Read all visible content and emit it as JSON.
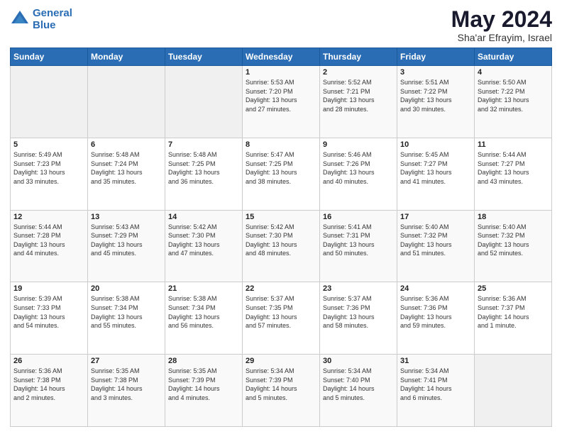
{
  "header": {
    "logo_line1": "General",
    "logo_line2": "Blue",
    "title": "May 2024",
    "subtitle": "Sha'ar Efrayim, Israel"
  },
  "days_of_week": [
    "Sunday",
    "Monday",
    "Tuesday",
    "Wednesday",
    "Thursday",
    "Friday",
    "Saturday"
  ],
  "weeks": [
    [
      {
        "day": "",
        "content": ""
      },
      {
        "day": "",
        "content": ""
      },
      {
        "day": "",
        "content": ""
      },
      {
        "day": "1",
        "content": "Sunrise: 5:53 AM\nSunset: 7:20 PM\nDaylight: 13 hours\nand 27 minutes."
      },
      {
        "day": "2",
        "content": "Sunrise: 5:52 AM\nSunset: 7:21 PM\nDaylight: 13 hours\nand 28 minutes."
      },
      {
        "day": "3",
        "content": "Sunrise: 5:51 AM\nSunset: 7:22 PM\nDaylight: 13 hours\nand 30 minutes."
      },
      {
        "day": "4",
        "content": "Sunrise: 5:50 AM\nSunset: 7:22 PM\nDaylight: 13 hours\nand 32 minutes."
      }
    ],
    [
      {
        "day": "5",
        "content": "Sunrise: 5:49 AM\nSunset: 7:23 PM\nDaylight: 13 hours\nand 33 minutes."
      },
      {
        "day": "6",
        "content": "Sunrise: 5:48 AM\nSunset: 7:24 PM\nDaylight: 13 hours\nand 35 minutes."
      },
      {
        "day": "7",
        "content": "Sunrise: 5:48 AM\nSunset: 7:25 PM\nDaylight: 13 hours\nand 36 minutes."
      },
      {
        "day": "8",
        "content": "Sunrise: 5:47 AM\nSunset: 7:25 PM\nDaylight: 13 hours\nand 38 minutes."
      },
      {
        "day": "9",
        "content": "Sunrise: 5:46 AM\nSunset: 7:26 PM\nDaylight: 13 hours\nand 40 minutes."
      },
      {
        "day": "10",
        "content": "Sunrise: 5:45 AM\nSunset: 7:27 PM\nDaylight: 13 hours\nand 41 minutes."
      },
      {
        "day": "11",
        "content": "Sunrise: 5:44 AM\nSunset: 7:27 PM\nDaylight: 13 hours\nand 43 minutes."
      }
    ],
    [
      {
        "day": "12",
        "content": "Sunrise: 5:44 AM\nSunset: 7:28 PM\nDaylight: 13 hours\nand 44 minutes."
      },
      {
        "day": "13",
        "content": "Sunrise: 5:43 AM\nSunset: 7:29 PM\nDaylight: 13 hours\nand 45 minutes."
      },
      {
        "day": "14",
        "content": "Sunrise: 5:42 AM\nSunset: 7:30 PM\nDaylight: 13 hours\nand 47 minutes."
      },
      {
        "day": "15",
        "content": "Sunrise: 5:42 AM\nSunset: 7:30 PM\nDaylight: 13 hours\nand 48 minutes."
      },
      {
        "day": "16",
        "content": "Sunrise: 5:41 AM\nSunset: 7:31 PM\nDaylight: 13 hours\nand 50 minutes."
      },
      {
        "day": "17",
        "content": "Sunrise: 5:40 AM\nSunset: 7:32 PM\nDaylight: 13 hours\nand 51 minutes."
      },
      {
        "day": "18",
        "content": "Sunrise: 5:40 AM\nSunset: 7:32 PM\nDaylight: 13 hours\nand 52 minutes."
      }
    ],
    [
      {
        "day": "19",
        "content": "Sunrise: 5:39 AM\nSunset: 7:33 PM\nDaylight: 13 hours\nand 54 minutes."
      },
      {
        "day": "20",
        "content": "Sunrise: 5:38 AM\nSunset: 7:34 PM\nDaylight: 13 hours\nand 55 minutes."
      },
      {
        "day": "21",
        "content": "Sunrise: 5:38 AM\nSunset: 7:34 PM\nDaylight: 13 hours\nand 56 minutes."
      },
      {
        "day": "22",
        "content": "Sunrise: 5:37 AM\nSunset: 7:35 PM\nDaylight: 13 hours\nand 57 minutes."
      },
      {
        "day": "23",
        "content": "Sunrise: 5:37 AM\nSunset: 7:36 PM\nDaylight: 13 hours\nand 58 minutes."
      },
      {
        "day": "24",
        "content": "Sunrise: 5:36 AM\nSunset: 7:36 PM\nDaylight: 13 hours\nand 59 minutes."
      },
      {
        "day": "25",
        "content": "Sunrise: 5:36 AM\nSunset: 7:37 PM\nDaylight: 14 hours\nand 1 minute."
      }
    ],
    [
      {
        "day": "26",
        "content": "Sunrise: 5:36 AM\nSunset: 7:38 PM\nDaylight: 14 hours\nand 2 minutes."
      },
      {
        "day": "27",
        "content": "Sunrise: 5:35 AM\nSunset: 7:38 PM\nDaylight: 14 hours\nand 3 minutes."
      },
      {
        "day": "28",
        "content": "Sunrise: 5:35 AM\nSunset: 7:39 PM\nDaylight: 14 hours\nand 4 minutes."
      },
      {
        "day": "29",
        "content": "Sunrise: 5:34 AM\nSunset: 7:39 PM\nDaylight: 14 hours\nand 5 minutes."
      },
      {
        "day": "30",
        "content": "Sunrise: 5:34 AM\nSunset: 7:40 PM\nDaylight: 14 hours\nand 5 minutes."
      },
      {
        "day": "31",
        "content": "Sunrise: 5:34 AM\nSunset: 7:41 PM\nDaylight: 14 hours\nand 6 minutes."
      },
      {
        "day": "",
        "content": ""
      }
    ]
  ]
}
